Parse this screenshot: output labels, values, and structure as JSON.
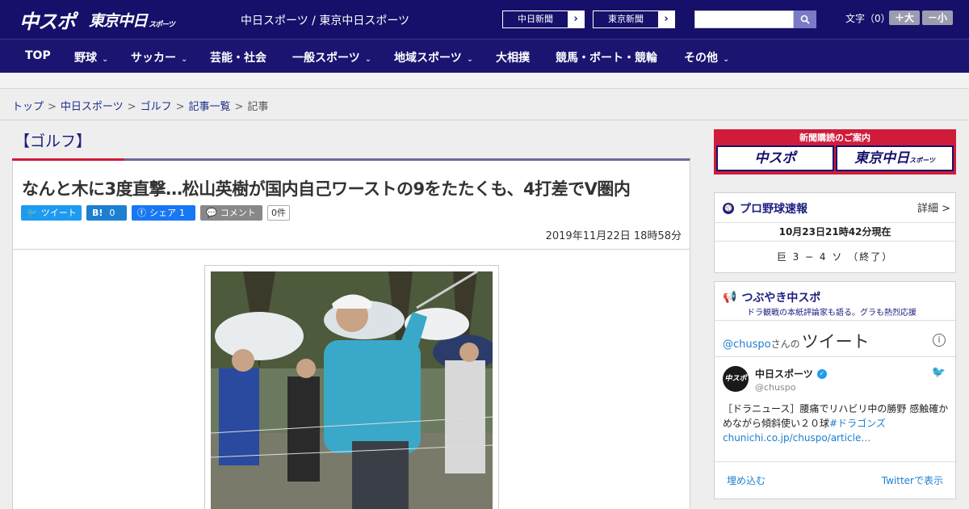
{
  "header": {
    "logo_chuspo": "中スポ",
    "logo_tokyo": "東京中日",
    "logo_tokyo_small": "スポーツ",
    "site_title": "中日スポーツ / 東京中日スポーツ",
    "btn_chunichi": "中日新聞",
    "btn_tokyo": "東京新聞",
    "btn_arrow": "›",
    "search_placeholder": "",
    "font_label": "文字（0）",
    "font_plus": "＋大",
    "font_minus": "－小"
  },
  "nav": {
    "items": [
      "TOP",
      "野球",
      "サッカー",
      "芸能・社会",
      "一般スポーツ",
      "地域スポーツ",
      "大相撲",
      "競馬・ボート・競輪",
      "その他"
    ],
    "chevron": "⌄"
  },
  "breadcrumb": {
    "items": [
      "トップ",
      "中日スポーツ",
      "ゴルフ",
      "記事一覧"
    ],
    "current": "記事",
    "sep": ">"
  },
  "article": {
    "category": "【ゴルフ】",
    "headline": "なんと木に3度直撃…松山英樹が国内自己ワーストの9をたたくも、4打差でV圏内",
    "date": "2019年11月22日 18時58分",
    "share": {
      "tweet": "ツイート",
      "hatena": "B!",
      "hatena_count": "0",
      "facebook": "シェア",
      "facebook_count": "1",
      "comment": "コメント",
      "comment_count": "0件"
    }
  },
  "sidebar": {
    "ad": {
      "head": "新聞購読のご案内",
      "logo_a": "中スポ",
      "logo_b": "東京中日",
      "logo_b_small": "スポーツ"
    },
    "baseball": {
      "title": "プロ野球速報",
      "detail": "詳細 >",
      "time": "10月23日21時42分現在",
      "score": "巨 3 − 4 ソ （終了）"
    },
    "tweets": {
      "title": "つぶやき中スポ",
      "subtitle": "ドラ観戦の本紙評論家も語る。グラも熱烈応援",
      "handle": "@chuspo",
      "handle_suffix": "さんの",
      "heading": "ツイート",
      "account_name": "中日スポーツ",
      "account_user": "@chuspo",
      "avatar_text": "中スポ",
      "text_main": "［ドラニュース］腰痛でリハビリ中の勝野 感触確かめながら傾斜使い２０球",
      "text_tag": "#ドラゴンズ",
      "text_link": "chunichi.co.jp/chuspo/article…",
      "embed": "埋め込む",
      "view": "Twitterで表示"
    }
  }
}
